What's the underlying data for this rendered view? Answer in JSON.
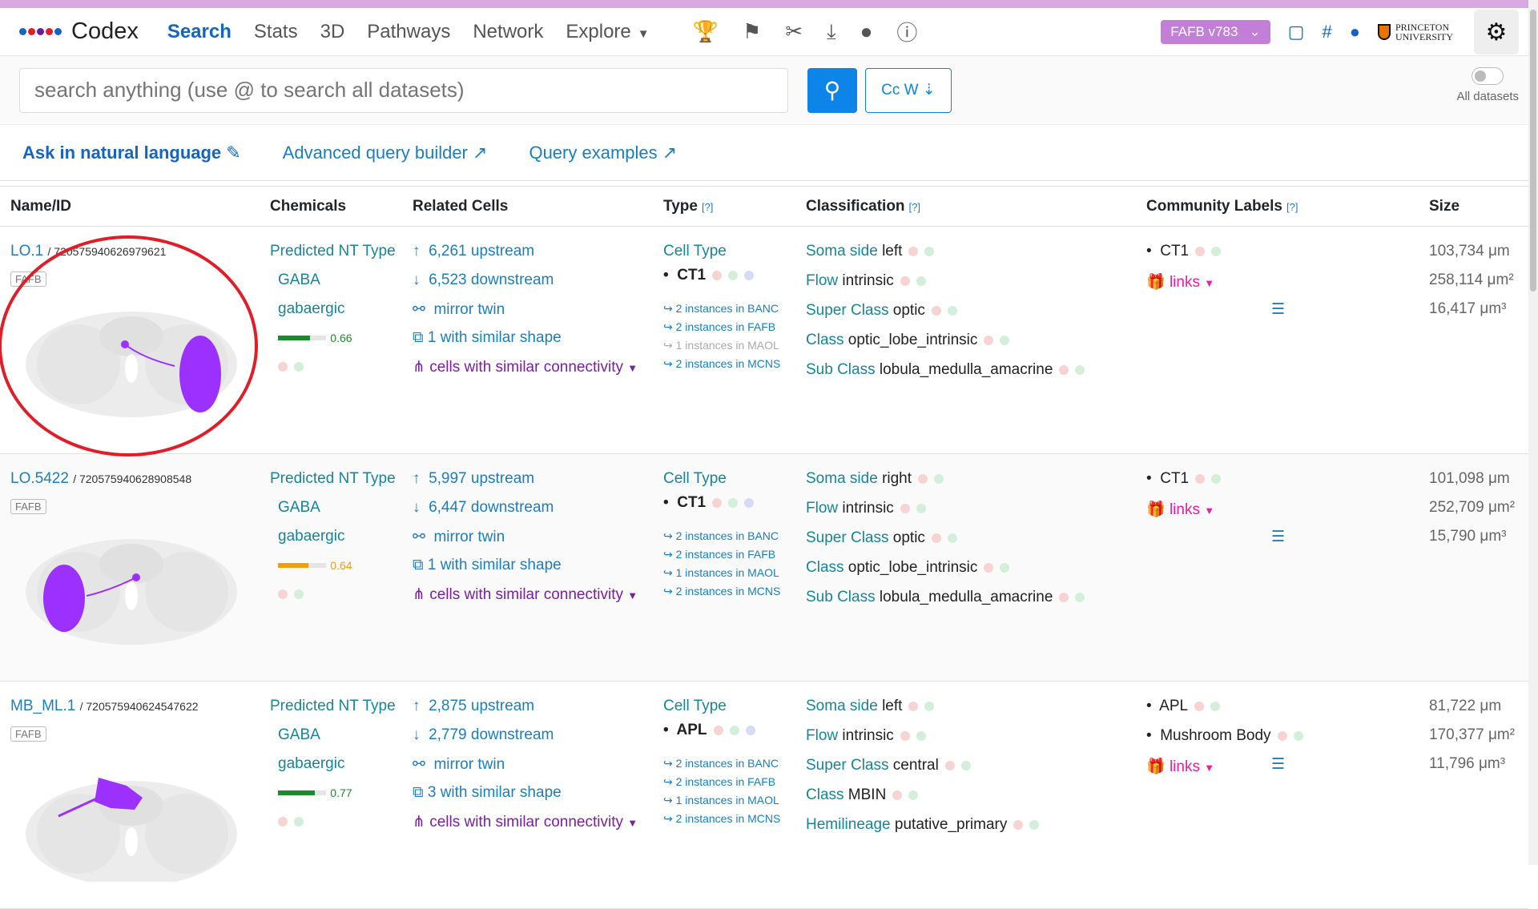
{
  "nav": {
    "brand": "Codex",
    "links": [
      "Search",
      "Stats",
      "3D",
      "Pathways",
      "Network",
      "Explore"
    ],
    "dataset": "FAFB v783",
    "princeton_line1": "PRINCETON",
    "princeton_line2": "UNIVERSITY"
  },
  "search": {
    "placeholder": "search anything (use @ to search all datasets)",
    "case_label": "Cc W",
    "toggle_label": "All datasets"
  },
  "query_links": {
    "natural": "Ask in natural language",
    "builder": "Advanced query builder",
    "examples": "Query examples"
  },
  "headers": {
    "name": "Name/ID",
    "chemicals": "Chemicals",
    "related": "Related Cells",
    "type": "Type",
    "classification": "Classification",
    "community": "Community Labels",
    "size": "Size",
    "help": "[?]"
  },
  "rows": [
    {
      "name": "LO.1",
      "id": "/ 720575940626979621",
      "badge": "FAFB",
      "nt_label": "Predicted NT Type",
      "nt": "GABA",
      "nt_sub": "gabaergic",
      "conf": "0.66",
      "conf_fraction": 0.66,
      "conf_color": "#1a8a2a",
      "upstream": "6,261 upstream",
      "downstream": "6,523 downstream",
      "mirror": "mirror twin",
      "similar_shape": "1 with similar shape",
      "similar_conn": "cells with similar connectivity",
      "cell_type_label": "Cell Type",
      "cell_type": "CT1",
      "inst": [
        "2 instances in BANC",
        "2 instances in FAFB",
        "1 instances in MAOL",
        "2 instances in MCNS"
      ],
      "cls": [
        [
          "Soma side",
          "left"
        ],
        [
          "Flow",
          "intrinsic"
        ],
        [
          "Super Class",
          "optic"
        ],
        [
          "Class",
          "optic_lobe_intrinsic"
        ],
        [
          "Sub Class",
          "lobula_medulla_amacrine"
        ]
      ],
      "community": [
        "CT1"
      ],
      "links": "links",
      "size": [
        "103,734 μm",
        "258,114 μm²",
        "16,417 μm³"
      ]
    },
    {
      "name": "LO.5422",
      "id": "/ 720575940628908548",
      "badge": "FAFB",
      "nt_label": "Predicted NT Type",
      "nt": "GABA",
      "nt_sub": "gabaergic",
      "conf": "0.64",
      "conf_fraction": 0.64,
      "conf_color": "#f59e0b",
      "upstream": "5,997 upstream",
      "downstream": "6,447 downstream",
      "mirror": "mirror twin",
      "similar_shape": "1 with similar shape",
      "similar_conn": "cells with similar connectivity",
      "cell_type_label": "Cell Type",
      "cell_type": "CT1",
      "inst": [
        "2 instances in BANC",
        "2 instances in FAFB",
        "1 instances in MAOL",
        "2 instances in MCNS"
      ],
      "cls": [
        [
          "Soma side",
          "right"
        ],
        [
          "Flow",
          "intrinsic"
        ],
        [
          "Super Class",
          "optic"
        ],
        [
          "Class",
          "optic_lobe_intrinsic"
        ],
        [
          "Sub Class",
          "lobula_medulla_amacrine"
        ]
      ],
      "community": [
        "CT1"
      ],
      "links": "links",
      "size": [
        "101,098 μm",
        "252,709 μm²",
        "15,790 μm³"
      ]
    },
    {
      "name": "MB_ML.1",
      "id": "/ 720575940624547622",
      "badge": "FAFB",
      "nt_label": "Predicted NT Type",
      "nt": "GABA",
      "nt_sub": "gabaergic",
      "conf": "0.77",
      "conf_fraction": 0.77,
      "conf_color": "#1a8a2a",
      "upstream": "2,875 upstream",
      "downstream": "2,779 downstream",
      "mirror": "mirror twin",
      "similar_shape": "3 with similar shape",
      "similar_conn": "cells with similar connectivity",
      "cell_type_label": "Cell Type",
      "cell_type": "APL",
      "inst": [
        "2 instances in BANC",
        "2 instances in FAFB",
        "1 instances in MAOL",
        "2 instances in MCNS"
      ],
      "cls": [
        [
          "Soma side",
          "left"
        ],
        [
          "Flow",
          "intrinsic"
        ],
        [
          "Super Class",
          "central"
        ],
        [
          "Class",
          "MBIN"
        ],
        [
          "Hemilineage",
          "putative_primary"
        ]
      ],
      "community": [
        "APL",
        "Mushroom Body"
      ],
      "links": "links",
      "size": [
        "81,722 μm",
        "170,377 μm²",
        "11,796 μm³"
      ]
    }
  ]
}
